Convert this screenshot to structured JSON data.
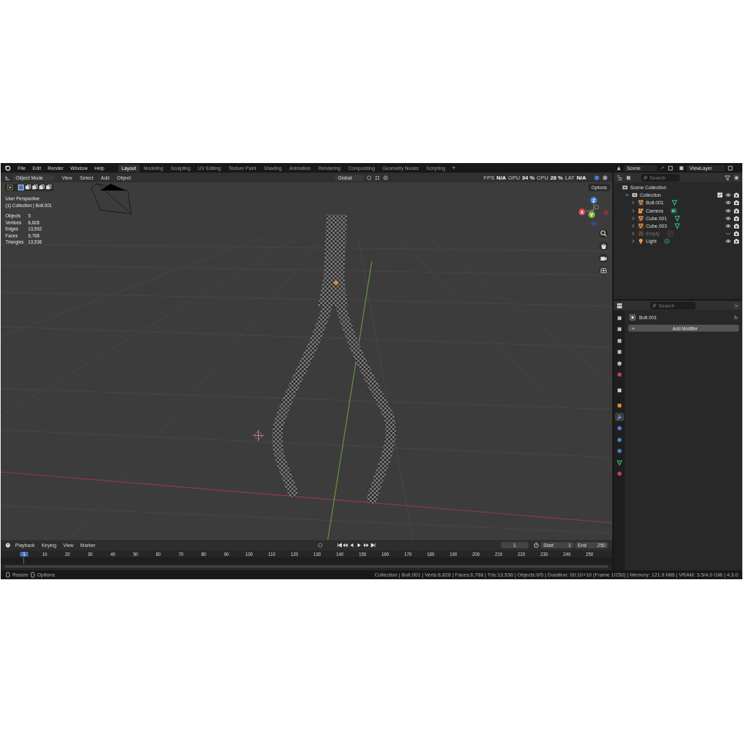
{
  "menu": [
    "File",
    "Edit",
    "Render",
    "Window",
    "Help"
  ],
  "workspaces": [
    {
      "label": "Layout",
      "selected": true
    },
    {
      "label": "Modeling",
      "selected": false
    },
    {
      "label": "Sculpting",
      "selected": false
    },
    {
      "label": "UV Editing",
      "selected": false
    },
    {
      "label": "Texture Paint",
      "selected": false
    },
    {
      "label": "Shading",
      "selected": false
    },
    {
      "label": "Animation",
      "selected": false
    },
    {
      "label": "Rendering",
      "selected": false
    },
    {
      "label": "Compositing",
      "selected": false
    },
    {
      "label": "Geometry Nodes",
      "selected": false
    },
    {
      "label": "Scripting",
      "selected": false
    }
  ],
  "add_workspace": "+",
  "scene": "Scene",
  "view_layer": "ViewLayer",
  "viewport": {
    "mode": "Object Mode",
    "menus": [
      "View",
      "Select",
      "Add",
      "Object"
    ],
    "orientation": "Global",
    "perf": [
      {
        "label": "FPS",
        "value": "N/A"
      },
      {
        "label": "GPU",
        "value": "34 %"
      },
      {
        "label": "CPU",
        "value": "28 %"
      },
      {
        "label": "LAT",
        "value": "N/A"
      }
    ],
    "options": "Options",
    "perspective": "User Perspective",
    "context": "(1) Collection | Bolt.001",
    "stats": [
      {
        "label": "Objects",
        "value": "5"
      },
      {
        "label": "Vertices",
        "value": "6,828"
      },
      {
        "label": "Edges",
        "value": "13,592"
      },
      {
        "label": "Faces",
        "value": "6,768"
      },
      {
        "label": "Triangles",
        "value": "13,536"
      }
    ],
    "gizmo": [
      "Z",
      "X",
      "Y"
    ]
  },
  "timeline": {
    "menus": [
      "Playback",
      "Keying",
      "View",
      "Marker"
    ],
    "frame": "1",
    "start_label": "Start",
    "start": "1",
    "end_label": "End",
    "end": "250",
    "current": "1",
    "ticks": [
      "10",
      "20",
      "30",
      "40",
      "50",
      "60",
      "70",
      "80",
      "90",
      "100",
      "110",
      "120",
      "130",
      "140",
      "150",
      "160",
      "170",
      "180",
      "190",
      "200",
      "210",
      "220",
      "230",
      "240",
      "250"
    ]
  },
  "outliner": {
    "search_placeholder": "Search",
    "tree": [
      {
        "name": "Scene Collection",
        "children": [
          {
            "name": "Collection",
            "checked": true,
            "expanded": true,
            "children": [
              {
                "name": "Bolt.001",
                "kind": "mesh",
                "visible": true
              },
              {
                "name": "Camera",
                "kind": "camera",
                "visible": true
              },
              {
                "name": "Cube.001",
                "kind": "mesh",
                "visible": true
              },
              {
                "name": "Cube.003",
                "kind": "mesh",
                "visible": true
              },
              {
                "name": "Empty",
                "kind": "empty",
                "visible": false
              },
              {
                "name": "Light",
                "kind": "light",
                "visible": true
              }
            ]
          }
        ]
      }
    ]
  },
  "properties": {
    "search_placeholder": "Search",
    "object": "Bolt.001",
    "add_icon": "+",
    "add_modifier": "Add Modifier",
    "tabs": [
      {
        "kind": "tool",
        "selected": false
      },
      {
        "kind": "render",
        "selected": false
      },
      {
        "kind": "output",
        "selected": false
      },
      {
        "kind": "view_layer",
        "selected": false
      },
      {
        "kind": "scene",
        "selected": false
      },
      {
        "kind": "world",
        "selected": false
      },
      {
        "kind": "collection",
        "selected": false
      },
      {
        "kind": "object",
        "selected": false
      },
      {
        "kind": "modifiers",
        "selected": true
      },
      {
        "kind": "particles",
        "selected": false
      },
      {
        "kind": "physics",
        "selected": false
      },
      {
        "kind": "constraints",
        "selected": false
      },
      {
        "kind": "data",
        "selected": false
      },
      {
        "kind": "material",
        "selected": false
      }
    ]
  },
  "status_bar": {
    "hints": [
      "Resize",
      "Options"
    ],
    "info": "Collection | Bolt.001 | Verts:6,828 | Faces:6,768 | Tris:13,536 | Objects:0/5 | Duration: 00:10+10 (Frame 1/250) | Memory: 121.9 MiB | VRAM: 3.5/4.0 GiB | 4.3.0"
  }
}
